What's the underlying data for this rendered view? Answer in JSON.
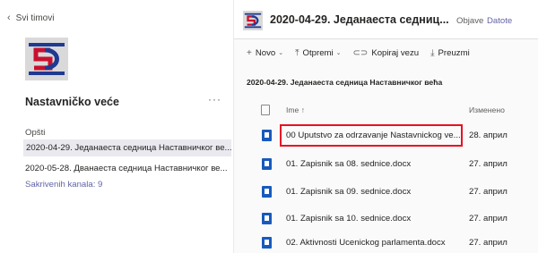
{
  "nav": {
    "back_label": "Svi timovi"
  },
  "team": {
    "name": "Nastavničko veće",
    "more_icon": "ellipsis-icon"
  },
  "channels": {
    "general": "Opšti",
    "items": [
      "2020-04-29. Једанаеста седница Наставничког ве...",
      "2020-05-28. Дванаеста седница Наставничког ве..."
    ],
    "hidden_link": "Sakrivenih kanala: 9"
  },
  "header": {
    "title": "2020-04-29. Једанаеста седниц...",
    "tabs": [
      "Objave",
      "Datote"
    ],
    "active_tab": "Datote"
  },
  "toolbar": {
    "new_label": "Novo",
    "upload_label": "Otpremi",
    "copy_link_label": "Kopiraj vezu",
    "download_label": "Preuzmi"
  },
  "folder": {
    "path": "2020-04-29. Једанаеста седница Наставничког већа"
  },
  "list": {
    "col_name": "Ime ↑",
    "col_modified": "Изменено",
    "rows": [
      {
        "name": "00 Uputstvo za odrzavanje Nastavnickog ve...",
        "date": "28. април"
      },
      {
        "name": "01. Zapisnik sa 08. sednice.docx",
        "date": "27. април"
      },
      {
        "name": "01. Zapisnik sa 09. sednice.docx",
        "date": "27. април"
      },
      {
        "name": "01. Zapisnik sa 10. sednice.docx",
        "date": "27. април"
      },
      {
        "name": "02. Aktivnosti Ucenickog parlamenta.docx",
        "date": "27. април"
      }
    ]
  },
  "colors": {
    "accent": "#6264a7",
    "highlight": "#e81123",
    "word": "#185abd",
    "logo_red": "#c8102e",
    "logo_blue": "#1f3a93"
  }
}
